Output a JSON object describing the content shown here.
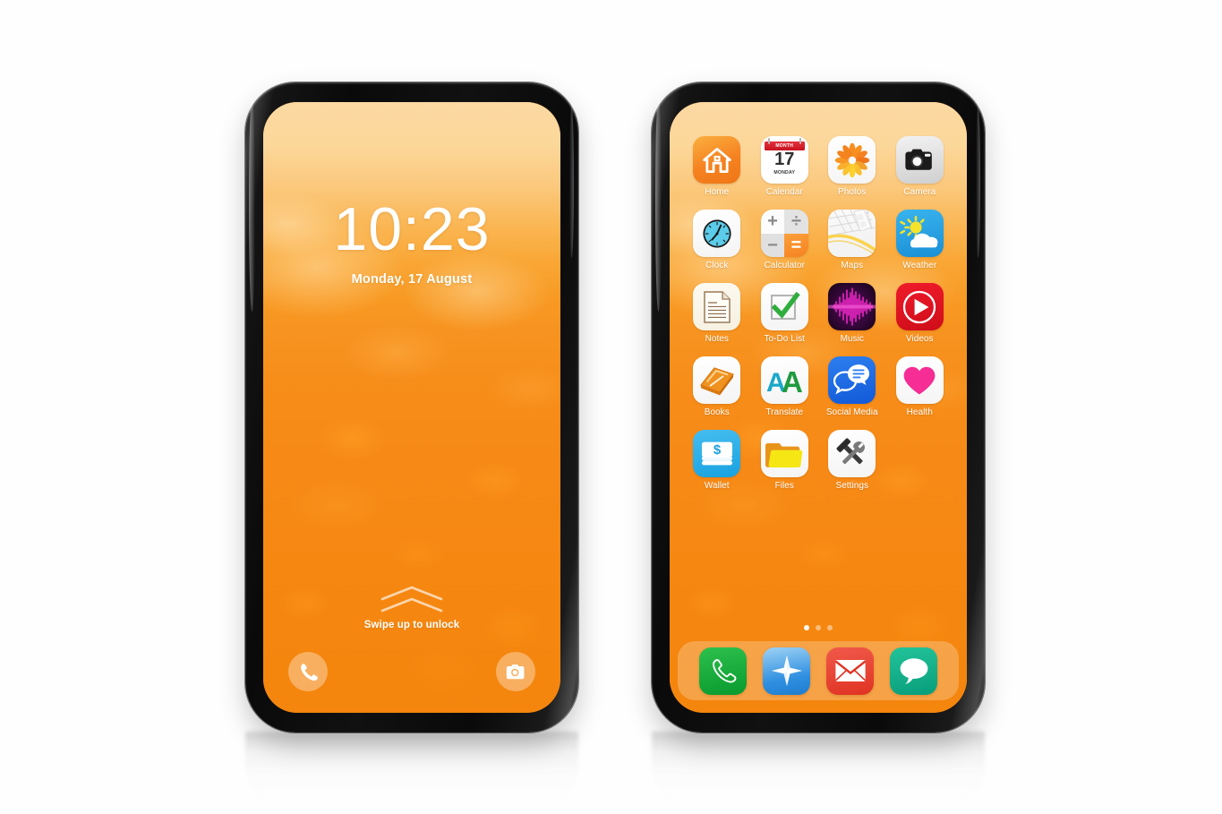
{
  "scene": {
    "background_color": "#ffffff",
    "device_count": 2,
    "bezel_color": "#111111",
    "wallpaper": {
      "style": "watercolor-orange-gradient",
      "top_color": "#fbd9a2",
      "bottom_color": "#f4850d",
      "accent_color": "#f58220"
    }
  },
  "lock_screen": {
    "name": "Lock Screen",
    "time": "10:23",
    "date": "Monday, 17 August",
    "swipe_hint": "Swipe up to unlock",
    "chevron_count": 2,
    "shortcuts": [
      {
        "name": "phone-shortcut",
        "icon": "phone-icon",
        "position": "bottom-left"
      },
      {
        "name": "camera-shortcut",
        "icon": "camera-icon",
        "position": "bottom-right"
      }
    ]
  },
  "home_screen": {
    "name": "Home Screen",
    "page_dots": {
      "total": 3,
      "active_index": 0
    },
    "apps": [
      {
        "label": "Home",
        "icon": "house-icon",
        "bg": "#f58220"
      },
      {
        "label": "Calendar",
        "icon": "calendar-icon",
        "bg": "#ffffff",
        "header_text": "MONTH",
        "day_number": "17",
        "day_name": "MONDAY",
        "header_color": "#d62030"
      },
      {
        "label": "Photos",
        "icon": "flower-icon",
        "bg": "#ffffff"
      },
      {
        "label": "Camera",
        "icon": "camera-icon",
        "bg": "#e6e6e6"
      },
      {
        "label": "Clock",
        "icon": "clock-icon",
        "bg": "#ffffff"
      },
      {
        "label": "Calculator",
        "icon": "calculator-icon",
        "bg": "#e6e6e6",
        "symbols": [
          "+",
          "÷",
          "−",
          "="
        ]
      },
      {
        "label": "Maps",
        "icon": "map-icon",
        "bg": "#fbfbfb"
      },
      {
        "label": "Weather",
        "icon": "sun-cloud-icon",
        "bg": "#2196d9"
      },
      {
        "label": "Notes",
        "icon": "note-page-icon",
        "bg": "#fdfaf1"
      },
      {
        "label": "To-Do List",
        "icon": "checkmark-icon",
        "bg": "#ffffff"
      },
      {
        "label": "Music",
        "icon": "waveform-icon",
        "bg": "#3a0840"
      },
      {
        "label": "Videos",
        "icon": "play-circle-icon",
        "bg": "#ef1b2a"
      },
      {
        "label": "Books",
        "icon": "book-icon",
        "bg": "#ffffff"
      },
      {
        "label": "Translate",
        "icon": "letter-a-a-icon",
        "bg": "#ffffff"
      },
      {
        "label": "Social Media",
        "icon": "chat-bubbles-icon",
        "bg": "#2d7ff0"
      },
      {
        "label": "Health",
        "icon": "heart-icon",
        "bg": "#ffffff"
      },
      {
        "label": "Wallet",
        "icon": "cash-stack-icon",
        "bg": "#39b4ee"
      },
      {
        "label": "Files",
        "icon": "folder-icon",
        "bg": "#ffffff"
      },
      {
        "label": "Settings",
        "icon": "tools-icon",
        "bg": "#ffffff"
      }
    ],
    "dock": [
      {
        "label": "Phone",
        "icon": "phone-icon",
        "bg": "#2ec04c"
      },
      {
        "label": "Compass",
        "icon": "compass-icon",
        "bg": "#2f8fe0"
      },
      {
        "label": "Mail",
        "icon": "envelope-icon",
        "bg": "#e03323"
      },
      {
        "label": "Messages",
        "icon": "speech-bubble-icon",
        "bg": "#22c39a"
      }
    ]
  }
}
